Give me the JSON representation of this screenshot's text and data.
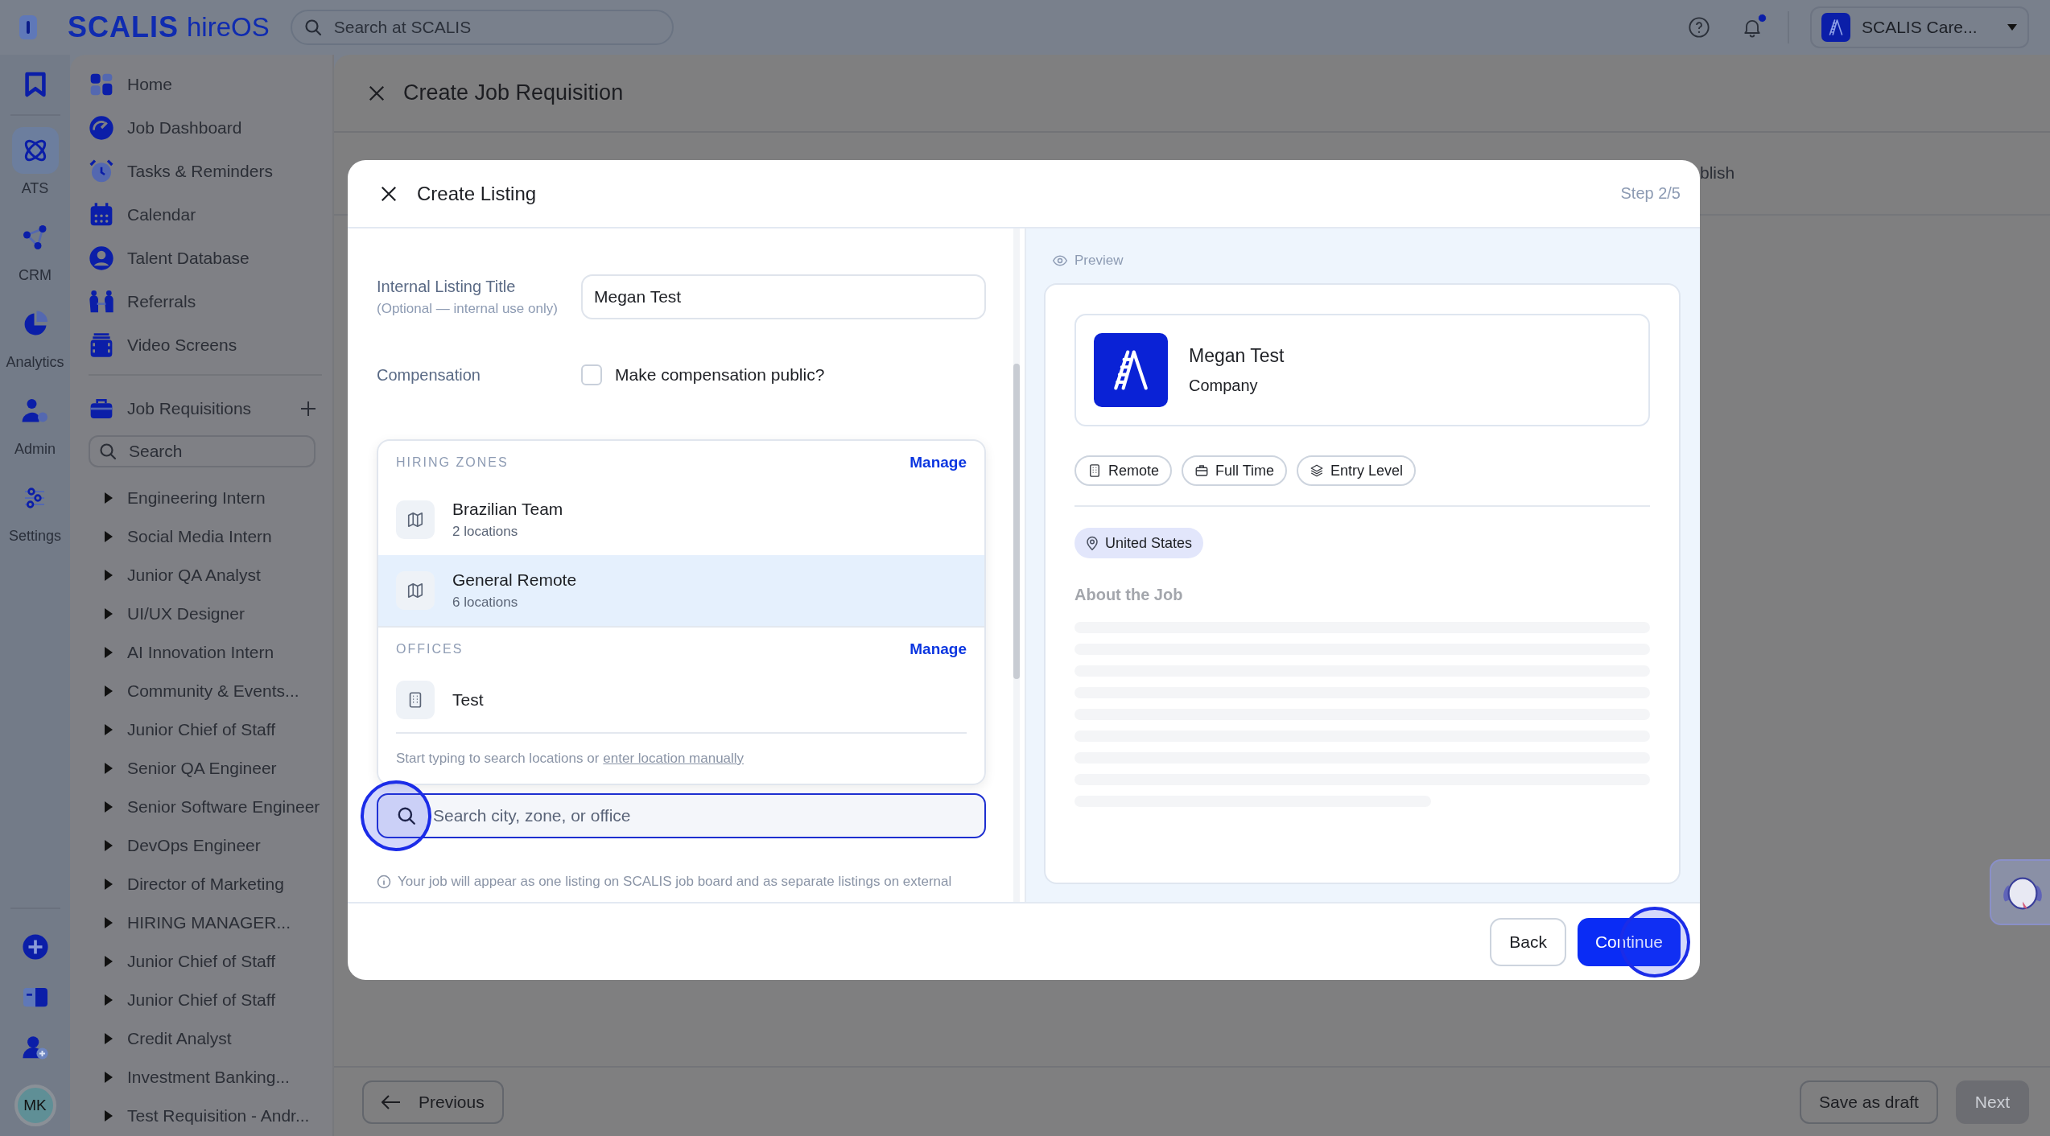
{
  "top_bar": {
    "brand": "SCALIS",
    "product": "hireOS",
    "search": {
      "placeholder": "Search at SCALIS"
    },
    "notifications": {
      "unread": true
    },
    "account": {
      "name": "SCALIS Care..."
    }
  },
  "rail": {
    "items": [
      {
        "label": "ATS",
        "selected": true
      },
      {
        "label": "CRM",
        "selected": false
      },
      {
        "label": "Analytics",
        "selected": false
      },
      {
        "label": "Admin",
        "selected": false
      },
      {
        "label": "Settings",
        "selected": false
      }
    ],
    "user": {
      "initials": "MK"
    }
  },
  "sidebar": {
    "nav": [
      {
        "label": "Home",
        "selected": false
      },
      {
        "label": "Job Dashboard",
        "selected": false
      },
      {
        "label": "Tasks & Reminders",
        "selected": false
      },
      {
        "label": "Calendar",
        "selected": false
      },
      {
        "label": "Talent Database",
        "selected": false
      },
      {
        "label": "Referrals",
        "selected": false
      },
      {
        "label": "Video Screens",
        "selected": false
      }
    ],
    "requisitions": {
      "title": "Job Requisitions",
      "search": {
        "placeholder": "Search"
      },
      "items": [
        {
          "label": "Engineering Intern",
          "expanded": false
        },
        {
          "label": "Social Media Intern",
          "expanded": false
        },
        {
          "label": "Junior QA Analyst",
          "expanded": false
        },
        {
          "label": "UI/UX Designer",
          "expanded": false
        },
        {
          "label": "AI Innovation Intern",
          "expanded": false
        },
        {
          "label": "Community & Events...",
          "expanded": false
        },
        {
          "label": "Junior Chief of Staff",
          "expanded": false
        },
        {
          "label": "Senior QA Engineer",
          "expanded": false
        },
        {
          "label": "Senior Software Engineer",
          "expanded": false
        },
        {
          "label": "DevOps Engineer",
          "expanded": false
        },
        {
          "label": "Director of Marketing",
          "expanded": false
        },
        {
          "label": "HIRING MANAGER...",
          "expanded": false
        },
        {
          "label": "Junior Chief of Staff",
          "expanded": false
        },
        {
          "label": "Junior Chief of Staff",
          "expanded": false
        },
        {
          "label": "Credit Analyst",
          "expanded": false
        },
        {
          "label": "Investment Banking...",
          "expanded": false
        },
        {
          "label": "Test Requisition - Andr...",
          "expanded": false
        }
      ]
    }
  },
  "page": {
    "title": "Create Job Requisition",
    "stepper_fragment": "blish",
    "footer": {
      "previous": "Previous",
      "save_draft": "Save as draft",
      "next": {
        "label": "Next",
        "disabled": true
      }
    }
  },
  "modal": {
    "title": "Create Listing",
    "step": "Step 2/5",
    "form": {
      "internal_title": {
        "label": "Internal Listing Title",
        "hint": "(Optional — internal use only)",
        "value": "Megan Test"
      },
      "compensation": {
        "label": "Compensation",
        "option": "Make compensation public?",
        "checked": false
      }
    },
    "location_menu": {
      "groups": [
        {
          "heading": "HIRING ZONES",
          "action": "Manage",
          "kind": "zone",
          "options": [
            {
              "name": "Brazilian Team",
              "detail": "2 locations",
              "selected": false
            },
            {
              "name": "General Remote",
              "detail": "6 locations",
              "selected": true
            }
          ]
        },
        {
          "heading": "OFFICES",
          "action": "Manage",
          "kind": "office",
          "options": [
            {
              "name": "Test",
              "selected": false
            }
          ]
        }
      ],
      "hint": "Start typing to search locations or",
      "hint_link": "enter location manually"
    },
    "location_search": {
      "placeholder": "Search city, zone, or office",
      "focused": true
    },
    "notice": "Your job will appear as one listing on SCALIS job board and as separate listings on external",
    "preview": {
      "label": "Preview",
      "company": {
        "name": "Megan Test",
        "subtitle": "Company"
      },
      "chips": [
        {
          "label": "Remote",
          "kind": "workplace"
        },
        {
          "label": "Full Time",
          "kind": "type"
        },
        {
          "label": "Entry Level",
          "kind": "level"
        }
      ],
      "location": "United States",
      "section_title": "About the Job"
    },
    "buttons": {
      "back": "Back",
      "continue": "Continue"
    }
  }
}
